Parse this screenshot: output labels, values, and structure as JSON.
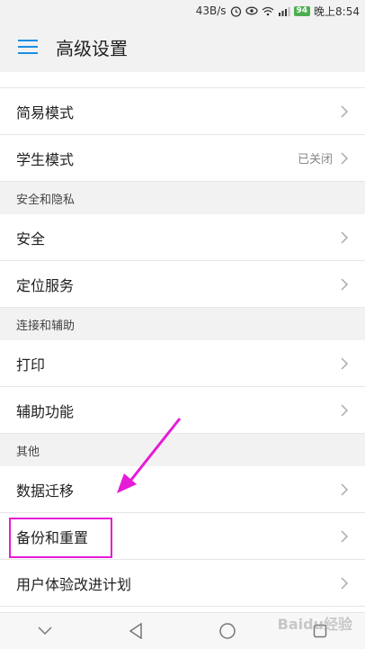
{
  "status_bar": {
    "net_speed": "43B/s",
    "battery": "94",
    "time": "晚上8:54"
  },
  "app_bar": {
    "title": "高级设置"
  },
  "list": {
    "rows_top": [
      {
        "label": "简易模式",
        "value": ""
      },
      {
        "label": "学生模式",
        "value": "已关闭"
      }
    ],
    "section_security": "安全和隐私",
    "rows_security": [
      {
        "label": "安全"
      },
      {
        "label": "定位服务"
      }
    ],
    "section_connect": "连接和辅助",
    "rows_connect": [
      {
        "label": "打印"
      },
      {
        "label": "辅助功能"
      }
    ],
    "section_other": "其他",
    "rows_other": [
      {
        "label": "数据迁移"
      },
      {
        "label": "备份和重置"
      },
      {
        "label": "用户体验改进计划"
      }
    ]
  },
  "annotations": {
    "highlight_color": "#e61bd8",
    "arrow_color": "#e61bd8"
  },
  "watermark": "Baidu经验"
}
